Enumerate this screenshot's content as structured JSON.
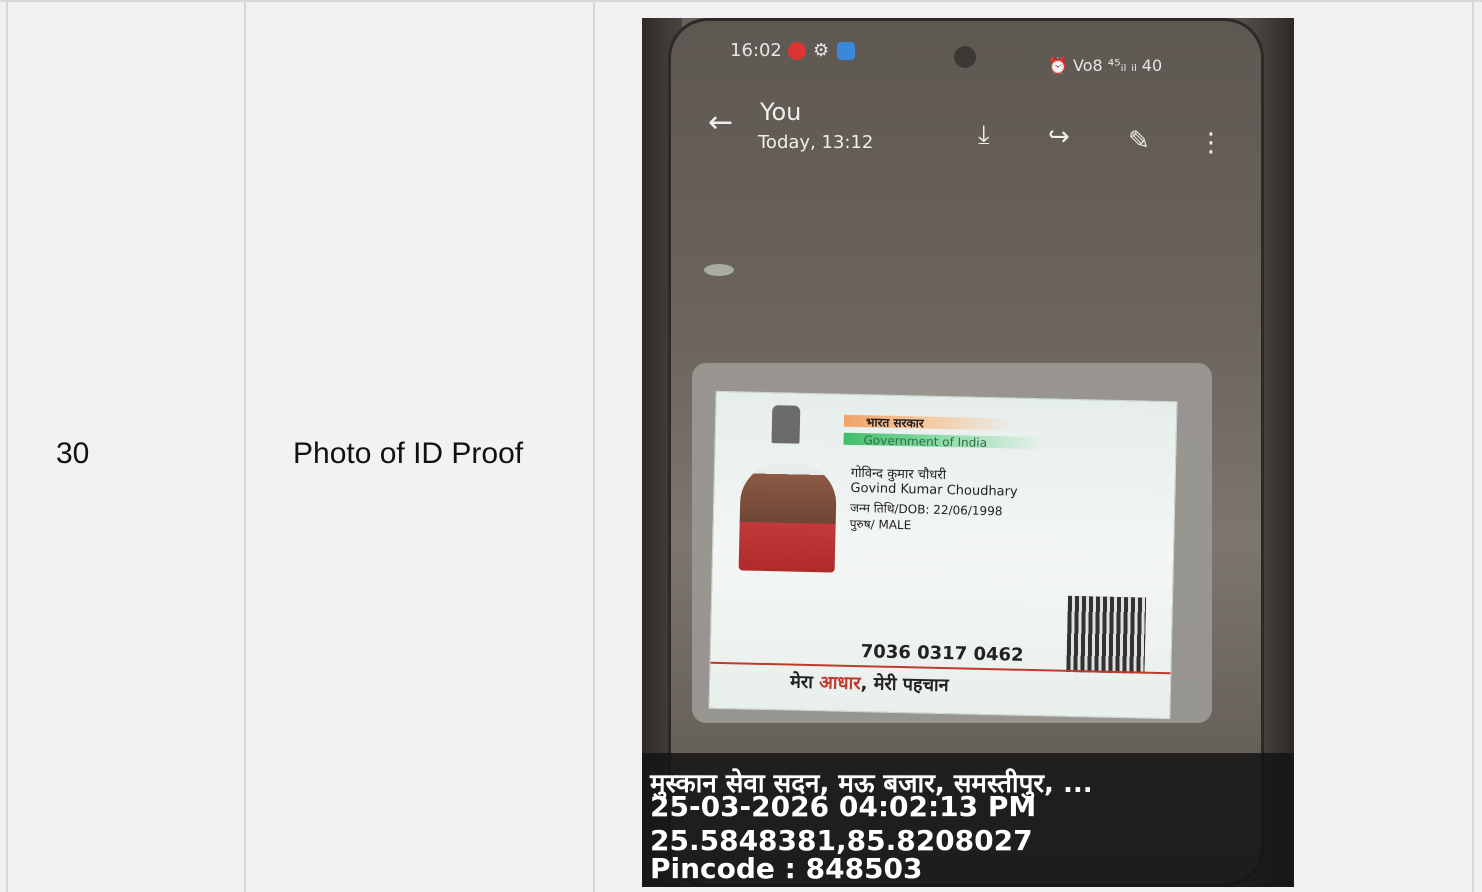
{
  "table_row": {
    "serial_number": "30",
    "label": "Photo of ID Proof"
  },
  "photo": {
    "status_bar": {
      "time": "16:02",
      "right_icons": "⏰ Vo8 ⁴⁵ᵢₗ ᵢₗ 40"
    },
    "viewer": {
      "sender": "You",
      "timestamp": "Today, 13:12"
    },
    "id_card": {
      "header_hindi": "भारत सरकार",
      "header_english": "Government of India",
      "name_hindi": "गोविन्द कुमार चौधरी",
      "name_english": "Govind Kumar Choudhary",
      "dob": "जन्म तिथि/DOB: 22/06/1998",
      "gender": "पुरुष/ MALE",
      "number": "7036 0317 0462",
      "tagline_part1": "मेरा",
      "tagline_part2": "आधार",
      "tagline_part3": ", मेरी पहचान"
    },
    "geo_overlay": {
      "address": "मुस्कान सेवा सदन, मऊ बजार, समस्तीपुर, ...",
      "datetime": "25-03-2026 04:02:13 PM",
      "coordinates": "25.5848381,85.8208027",
      "pincode": "Pincode : 848503"
    }
  },
  "colors": {
    "page_bg": "#f2f2f2",
    "grid_line": "#d9d9d9",
    "tagline_red": "#c0392b"
  }
}
